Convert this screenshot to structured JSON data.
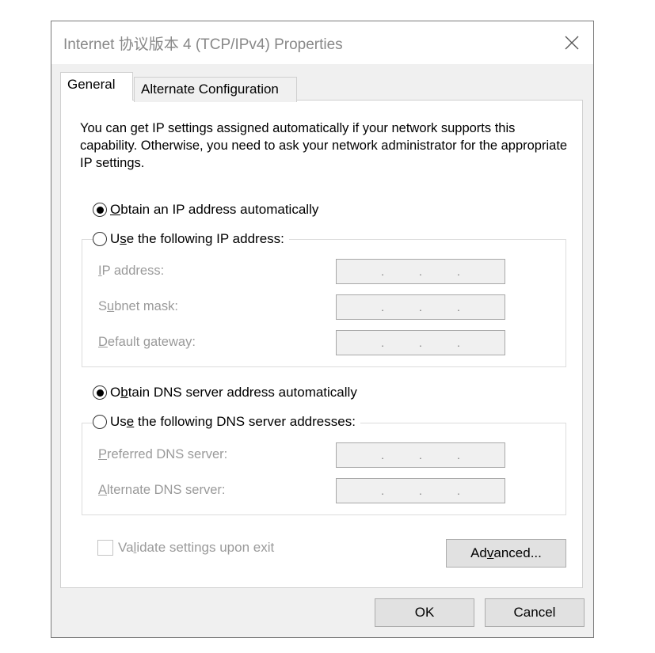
{
  "window": {
    "title": "Internet 协议版本 4 (TCP/IPv4) Properties",
    "close_glyph": "✕"
  },
  "tabs": [
    {
      "label": "General",
      "selected": true
    },
    {
      "label": "Alternate Configuration",
      "selected": false
    }
  ],
  "intro_text": "You can get IP settings assigned automatically if your network supports this capability. Otherwise, you need to ask your network administrator for the appropriate IP settings.",
  "ip_options": {
    "auto": {
      "pre": "",
      "mnemonic": "O",
      "post": "btain an IP address automatically",
      "selected": true
    },
    "manual": {
      "pre": "U",
      "mnemonic": "s",
      "post": "e the following IP address:",
      "selected": false
    }
  },
  "ip_fields": [
    {
      "pre": "",
      "mnemonic": "I",
      "post": "P address:",
      "value": ". . ."
    },
    {
      "pre": "S",
      "mnemonic": "u",
      "post": "bnet mask:",
      "value": ". . ."
    },
    {
      "pre": "",
      "mnemonic": "D",
      "post": "efault gateway:",
      "value": ". . ."
    }
  ],
  "dns_options": {
    "auto": {
      "pre": "O",
      "mnemonic": "b",
      "post": "tain DNS server address automatically",
      "selected": true
    },
    "manual": {
      "pre": "Us",
      "mnemonic": "e",
      "post": " the following DNS server addresses:",
      "selected": false
    }
  },
  "dns_fields": [
    {
      "pre": "",
      "mnemonic": "P",
      "post": "referred DNS server:",
      "value": ". . ."
    },
    {
      "pre": "",
      "mnemonic": "A",
      "post": "lternate DNS server:",
      "value": ". . ."
    }
  ],
  "validate": {
    "pre": "Va",
    "mnemonic": "l",
    "post": "idate settings upon exit",
    "checked": false
  },
  "buttons": {
    "advanced": {
      "pre": "Ad",
      "mnemonic": "v",
      "post": "anced..."
    },
    "ok": "OK",
    "cancel": "Cancel"
  }
}
